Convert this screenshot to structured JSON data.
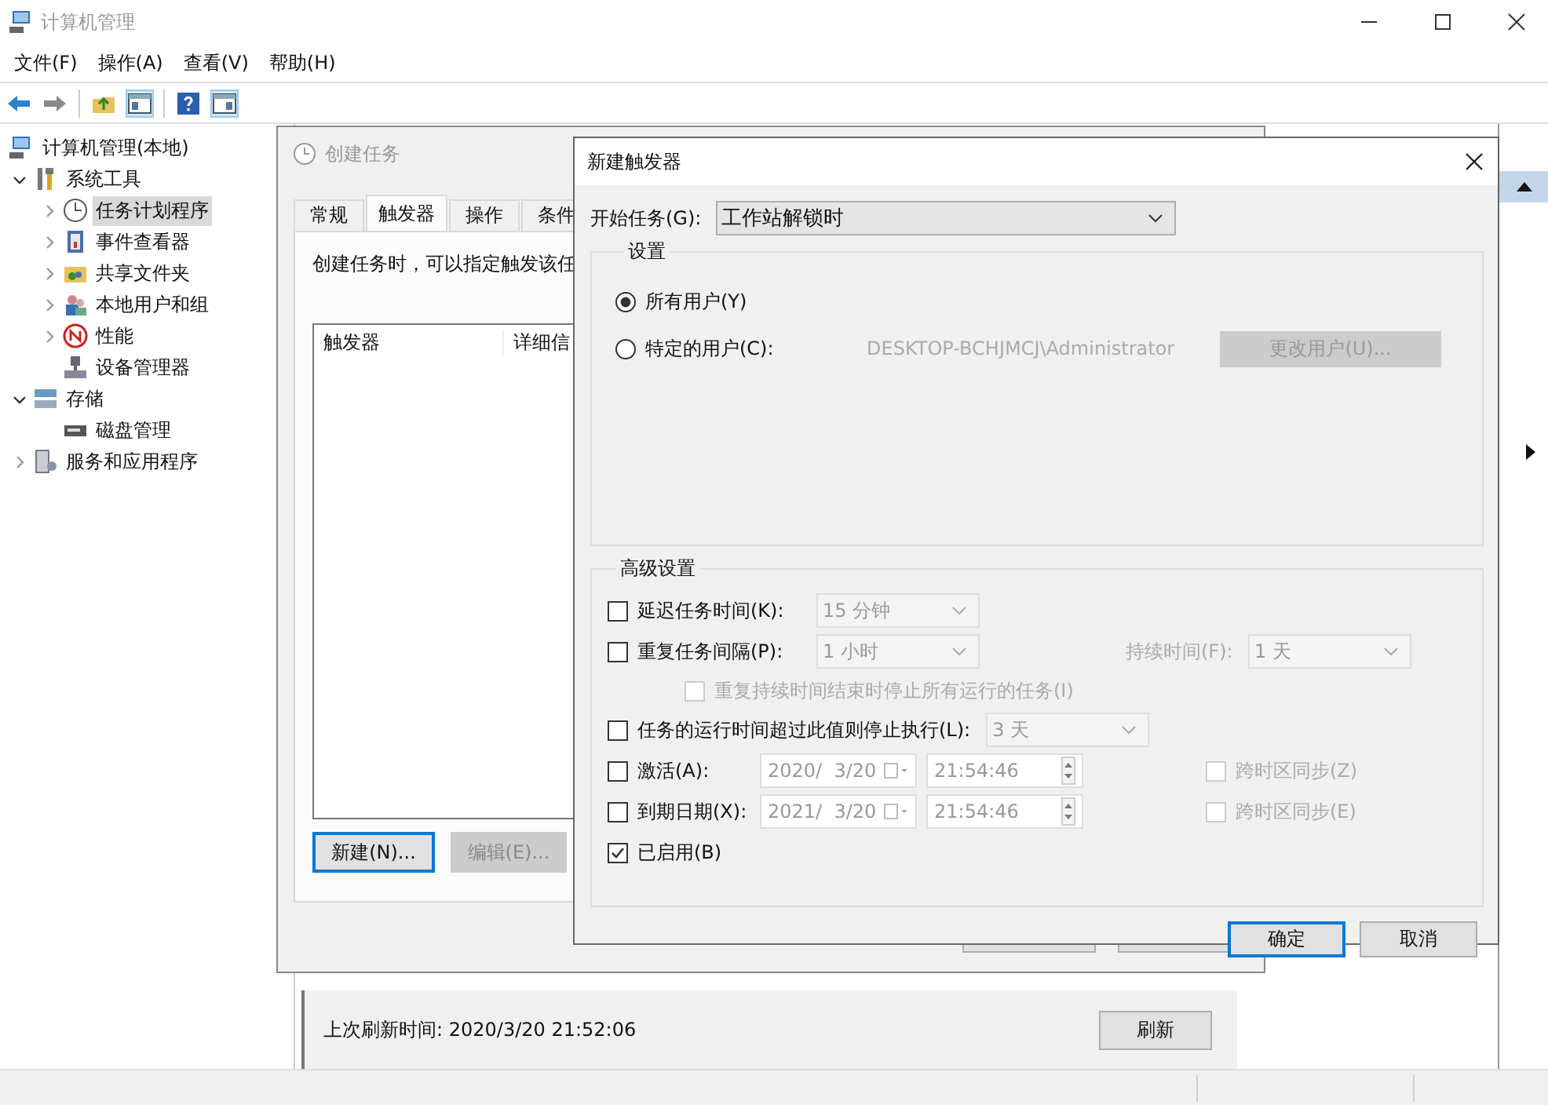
{
  "window": {
    "title": "计算机管理"
  },
  "menu": [
    "文件(F)",
    "操作(A)",
    "查看(V)",
    "帮助(H)"
  ],
  "tree": [
    {
      "label": "计算机管理(本地)",
      "kind": "computer",
      "selected": false,
      "children": [
        {
          "label": "系统工具",
          "kind": "tools",
          "expandable": true,
          "expanded": true,
          "selected": false,
          "children": [
            {
              "label": "任务计划程序",
              "kind": "clock",
              "expandable": true,
              "expanded": false,
              "selected": true
            },
            {
              "label": "事件查看器",
              "kind": "event",
              "expandable": true,
              "expanded": false,
              "selected": false
            },
            {
              "label": "共享文件夹",
              "kind": "share",
              "expandable": true,
              "expanded": false,
              "selected": false
            },
            {
              "label": "本地用户和组",
              "kind": "users",
              "expandable": true,
              "expanded": false,
              "selected": false
            },
            {
              "label": "性能",
              "kind": "perf",
              "expandable": true,
              "expanded": false,
              "selected": false
            },
            {
              "label": "设备管理器",
              "kind": "device",
              "expandable": false,
              "selected": false
            }
          ]
        },
        {
          "label": "存储",
          "kind": "storage",
          "expandable": true,
          "expanded": true,
          "selected": false,
          "children": [
            {
              "label": "磁盘管理",
              "kind": "disk",
              "expandable": false,
              "selected": false
            }
          ]
        },
        {
          "label": "服务和应用程序",
          "kind": "services",
          "expandable": true,
          "expanded": false,
          "selected": false
        }
      ]
    }
  ],
  "scheduler_pane": {
    "last_refresh": "上次刷新时间: 2020/3/20 21:52:06",
    "refresh_button": "刷新"
  },
  "create_task_dialog": {
    "title": "创建任务",
    "tabs": [
      {
        "label": "常规",
        "selected": false
      },
      {
        "label": "触发器",
        "selected": true
      },
      {
        "label": "操作",
        "selected": false
      },
      {
        "label": "条件",
        "selected": false
      }
    ],
    "description": "创建任务时，可以指定触发该任",
    "list_columns": [
      "触发器",
      "详细信"
    ],
    "buttons": [
      {
        "label": "新建(N)...",
        "focused": true,
        "disabled": false
      },
      {
        "label": "编辑(E)...",
        "focused": false,
        "disabled": true
      }
    ]
  },
  "trigger_dialog": {
    "title": "新建触发器",
    "begin_label": "开始任务(G):",
    "begin_value": "工作站解锁时",
    "settings_title": "设置",
    "user_options": [
      {
        "label": "所有用户(Y)",
        "selected": true
      },
      {
        "label": "特定的用户(C):",
        "selected": false
      }
    ],
    "user_name": "DESKTOP-BCHJMCJ\\Administrator",
    "change_user_button": {
      "label": "更改用户(U)...",
      "disabled": true
    },
    "advanced_title": "高级设置",
    "advanced_rows": [
      {
        "kind": "dropdown",
        "label": "延迟任务时间(K):",
        "checked": false,
        "value": "15 分钟"
      },
      {
        "kind": "repeat",
        "label": "重复任务间隔(P):",
        "checked": false,
        "value": "1 小时",
        "duration_label": "持续时间(F):",
        "duration_value": "1 天"
      },
      {
        "kind": "sub",
        "label": "重复持续时间结束时停止所有运行的任务(I)",
        "checked": false,
        "disabled": true
      },
      {
        "kind": "dropdown",
        "label": "任务的运行时间超过此值则停止执行(L):",
        "checked": false,
        "value": "3 天"
      },
      {
        "kind": "datetime",
        "label": "激活(A):",
        "checked": false,
        "date": "2020/  3/20",
        "time": "21:54:46",
        "sync_label": "跨时区同步(Z)",
        "sync_checked": false
      },
      {
        "kind": "datetime",
        "label": "到期日期(X):",
        "checked": false,
        "date": "2021/  3/20",
        "time": "21:54:46",
        "sync_label": "跨时区同步(E)",
        "sync_checked": false
      },
      {
        "kind": "check",
        "label": "已启用(B)",
        "checked": true
      }
    ],
    "buttons": [
      {
        "label": "确定",
        "default": true
      },
      {
        "label": "取消",
        "default": false
      }
    ]
  }
}
